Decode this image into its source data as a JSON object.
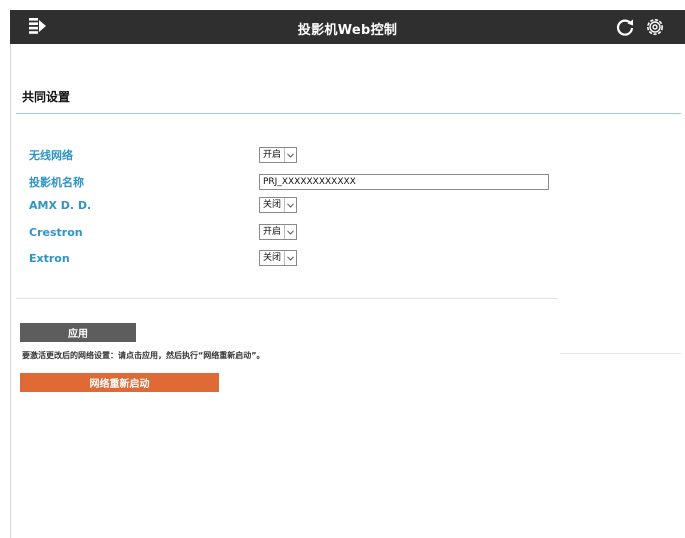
{
  "app": {
    "title": "投影机Web控制",
    "header_bg": "#2f2f2f",
    "icons": {
      "menu": "menu-collapse-icon",
      "refresh": "refresh-icon",
      "settings": "gear-icon"
    }
  },
  "section": {
    "title": "共同设置"
  },
  "settings": {
    "wireless": {
      "label": "无线网络",
      "value": "开启"
    },
    "projector_name": {
      "label": "投影机名称",
      "value": "PRJ_XXXXXXXXXXXX"
    },
    "amx": {
      "label": "AMX D. D.",
      "value": "关闭"
    },
    "crestron": {
      "label": "Crestron",
      "value": "开启"
    },
    "extron": {
      "label": "Extron",
      "value": "关闭"
    }
  },
  "actions": {
    "apply_label": "应用",
    "note": "要激活更改后的网络设置：请点击应用，然后执行“网络重新启动”。",
    "restart_label": "网络重新启动"
  },
  "colors": {
    "label_blue": "#2e95c8",
    "apply_gray": "#5d5d5d",
    "restart_orange": "#e06a35",
    "section_line": "#9fcbe4"
  }
}
